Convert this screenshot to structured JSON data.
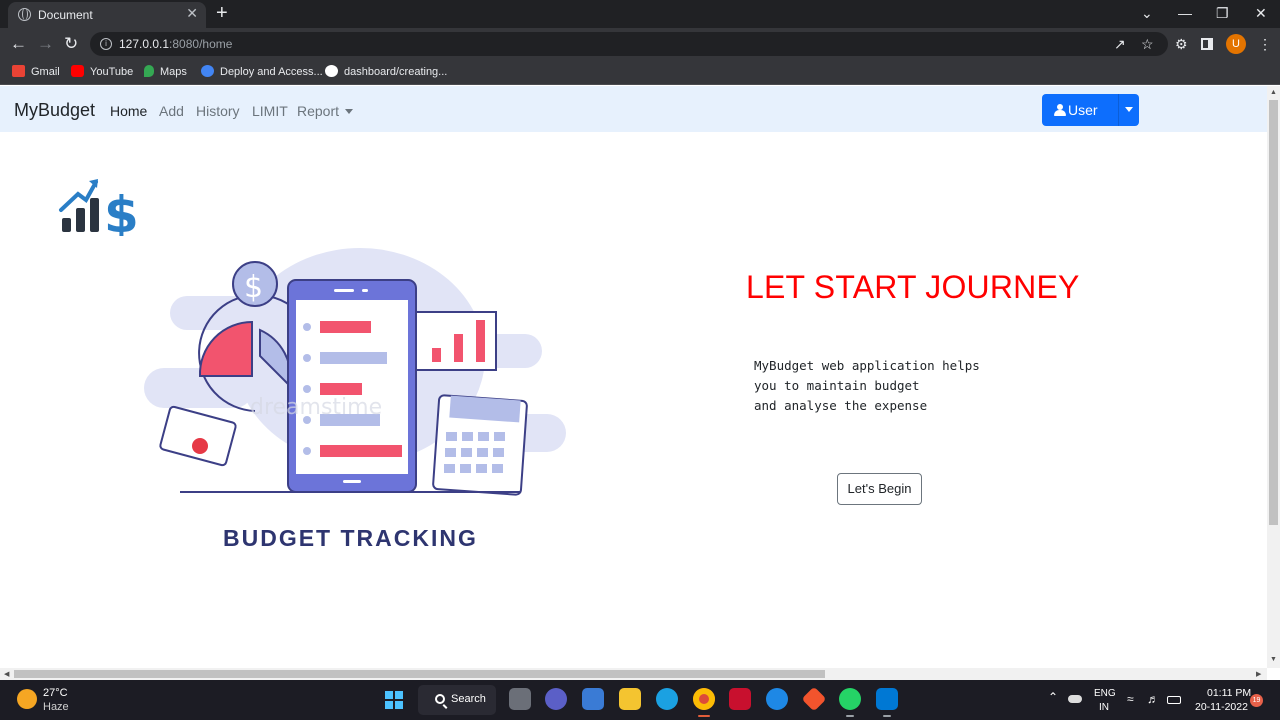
{
  "browser": {
    "tab_title": "Document",
    "tab_close": "✕",
    "new_tab": "+",
    "url_host": "127.0.0.1",
    "url_rest": ":8080/home",
    "profile_initial": "U",
    "window_controls": {
      "chevron": "⌄",
      "minimize": "—",
      "maximize": "❐",
      "close": "✕"
    },
    "bookmarks": [
      {
        "label": "Gmail",
        "icon": "gmail-icon",
        "color": "#ea4335"
      },
      {
        "label": "YouTube",
        "icon": "youtube-icon",
        "color": "#ff0000"
      },
      {
        "label": "Maps",
        "icon": "maps-icon",
        "color": "#34a853"
      },
      {
        "label": "Deploy and Access...",
        "icon": "deploy-icon",
        "color": "#4285f4"
      },
      {
        "label": "dashboard/creating...",
        "icon": "github-icon",
        "color": "#ffffff"
      }
    ]
  },
  "navbar": {
    "brand": "MyBudget",
    "links": [
      "Home",
      "Add",
      "History",
      "LIMIT",
      "Report"
    ],
    "active": "Home",
    "user_button": "User",
    "accent_color": "#0d6efd"
  },
  "hero": {
    "title": "LET START JOURNEY",
    "description_lines": [
      "MyBudget web application helps",
      "you to maintain budget",
      "and analyse the expense"
    ],
    "button": "Let's Begin",
    "illustration_caption": "BUDGET TRACKING",
    "illustration_watermark": "dreamstime",
    "title_color": "#ff0000"
  },
  "taskbar": {
    "temperature": "27°C",
    "condition": "Haze",
    "search_label": "Search",
    "language_line1": "ENG",
    "language_line2": "IN",
    "time": "01:11 PM",
    "date": "20-11-2022",
    "notification_count": "19"
  }
}
